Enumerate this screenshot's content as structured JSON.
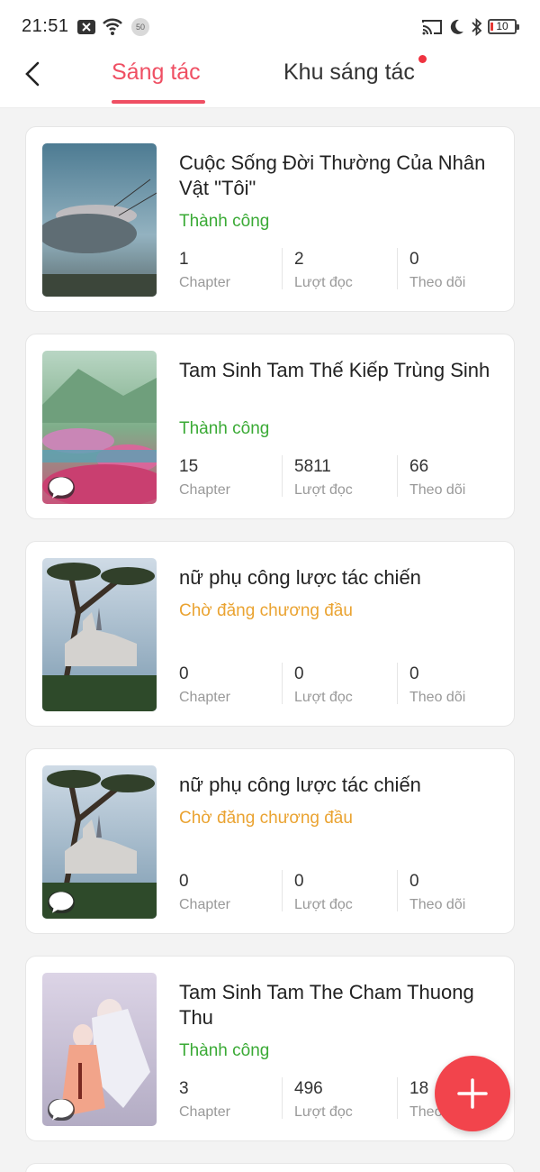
{
  "status_bar": {
    "time": "21:51",
    "notification_count": "50",
    "battery_level": "10",
    "icons": [
      "close-box-icon",
      "wifi-icon",
      "cast-icon",
      "moon-icon",
      "bluetooth-icon",
      "battery-icon"
    ]
  },
  "header": {
    "back_icon": "chevron-left-icon",
    "tabs": [
      {
        "label": "Sáng tác",
        "active": true
      },
      {
        "label": "Khu sáng tác",
        "active": false,
        "has_dot": true
      }
    ]
  },
  "colors": {
    "accent": "#ef4f63",
    "success": "#3aaa35",
    "pending": "#eaa331",
    "fab": "#f2444c"
  },
  "stats_labels": {
    "chapter": "Chapter",
    "reads": "Lượt đọc",
    "follows": "Theo dõi"
  },
  "stories": [
    {
      "title": "Cuộc Sống Đời Thường Của Nhân Vật \"Tôi\"",
      "status": "Thành công",
      "status_type": "success",
      "chapters": "1",
      "reads": "2",
      "follows": "0",
      "has_chat_icon": false
    },
    {
      "title": "Tam Sinh Tam Thế Kiếp Trùng Sinh",
      "status": "Thành công",
      "status_type": "success",
      "chapters": "15",
      "reads": "5811",
      "follows": "66",
      "has_chat_icon": true
    },
    {
      "title": "nữ phụ công lược tác chiến",
      "status": "Chờ đăng chương đầu",
      "status_type": "pending",
      "chapters": "0",
      "reads": "0",
      "follows": "0",
      "has_chat_icon": false
    },
    {
      "title": "nữ phụ công lược tác chiến",
      "status": "Chờ đăng chương đầu",
      "status_type": "pending",
      "chapters": "0",
      "reads": "0",
      "follows": "0",
      "has_chat_icon": true
    },
    {
      "title": "Tam Sinh Tam The Cham Thuong Thu",
      "status": "Thành công",
      "status_type": "success",
      "chapters": "3",
      "reads": "496",
      "follows": "18",
      "has_chat_icon": true
    }
  ],
  "fab": {
    "icon": "plus-icon"
  }
}
